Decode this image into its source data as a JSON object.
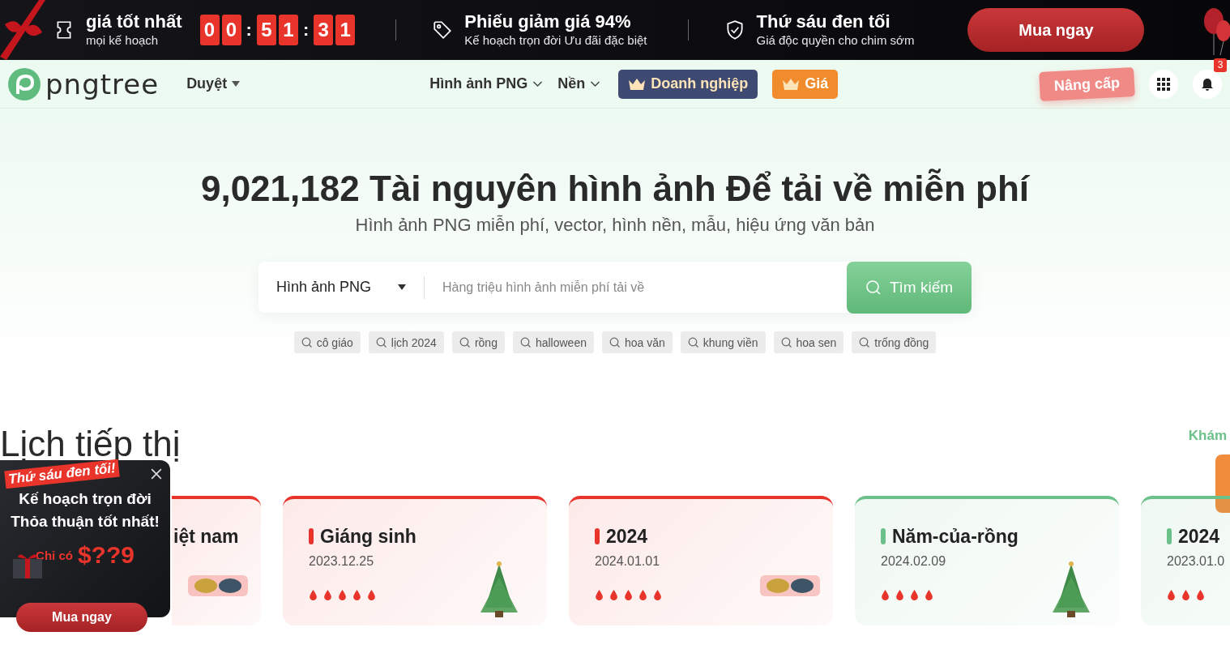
{
  "promo_bar": {
    "offers": [
      {
        "kind": "ticket",
        "title": "giá tốt nhất",
        "subtitle": "mọi kế hoạch"
      },
      {
        "kind": "tag",
        "title": "Phiếu giảm giá 94%",
        "subtitle": "Kế hoạch trọn đời Ưu đãi đặc biệt"
      },
      {
        "kind": "shield",
        "title": "Thứ sáu đen tối",
        "subtitle": "Giá độc quyền cho chim sớm"
      }
    ],
    "countdown": [
      {
        "kind": "digit",
        "text": "0"
      },
      {
        "kind": "digit",
        "text": "0"
      },
      {
        "kind": "sep",
        "text": ":"
      },
      {
        "kind": "digit",
        "text": "5"
      },
      {
        "kind": "digit",
        "text": "1"
      },
      {
        "kind": "sep",
        "text": ":"
      },
      {
        "kind": "digit",
        "text": "3"
      },
      {
        "kind": "digit",
        "text": "1"
      }
    ],
    "button": "Mua ngay"
  },
  "nav": {
    "logo": "pngtree",
    "browse": "Duyệt",
    "menu": [
      {
        "kind": "dropdown",
        "label": "Hình ảnh PNG"
      },
      {
        "kind": "dropdown",
        "label": "Nền"
      },
      {
        "kind": "business",
        "label": "Doanh nghiệp"
      },
      {
        "kind": "pricing",
        "label": "Giá"
      }
    ],
    "upgrade": "Nâng cấp",
    "notifications": "3"
  },
  "hero": {
    "title": "9,021,182 Tài nguyên hình ảnh Để tải về miễn phí",
    "subtitle": "Hình ảnh PNG miễn phí, vector, hình nền, mẫu, hiệu ứng văn bản",
    "search": {
      "category": "Hình ảnh PNG",
      "placeholder": "Hàng triệu hình ảnh miễn phí tải về",
      "button": "Tìm kiếm"
    },
    "tags": [
      "cô giáo",
      "lịch 2024",
      "rồng",
      "halloween",
      "hoa văn",
      "khung viền",
      "hoa sen",
      "trống đồng"
    ]
  },
  "calendar": {
    "title": "Lịch tiếp thị",
    "more": "Khám",
    "cards": [
      {
        "kind": "covered",
        "title": "iệt nam",
        "color": "#e8342a"
      },
      {
        "kind": "full",
        "title": "Giáng sinh",
        "date": "2023.12.25",
        "stars": 5,
        "color": "#e8342a"
      },
      {
        "kind": "full",
        "title": "2024",
        "date": "2024.01.01",
        "stars": 5,
        "color": "#e8342a"
      },
      {
        "kind": "full",
        "title": "Năm-của-rồng",
        "date": "2024.02.09",
        "stars": 4,
        "color": "#6cc08a"
      },
      {
        "kind": "cut",
        "title": "2024",
        "date": "2023.01.0",
        "stars": 3,
        "color": "#6cc08a"
      }
    ]
  },
  "popup": {
    "ribbon": "Thứ sáu đen tối!",
    "title": "Kế hoạch trọn đời Thỏa thuận tốt nhất!",
    "price_label": "Chỉ có",
    "price": "$??9",
    "button": "Mua ngay"
  }
}
